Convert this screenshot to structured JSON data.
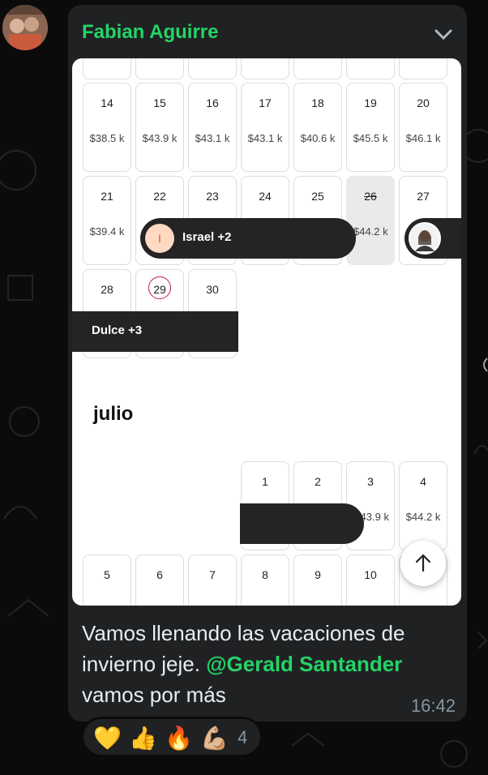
{
  "message": {
    "sender": "Fabian Aguirre",
    "text_before": "Vamos llenando las vacaciones de invierno jeje. ",
    "mention": "@Gerald Santander",
    "text_after": " vamos por más",
    "time": "16:42"
  },
  "screenshot": {
    "rows": [
      [
        {
          "day": "14",
          "price": "$38.5 k"
        },
        {
          "day": "15",
          "price": "$43.9 k"
        },
        {
          "day": "16",
          "price": "$43.1 k"
        },
        {
          "day": "17",
          "price": "$43.1 k"
        },
        {
          "day": "18",
          "price": "$40.6 k"
        },
        {
          "day": "19",
          "price": "$45.5 k"
        },
        {
          "day": "20",
          "price": "$46.1 k"
        }
      ],
      [
        {
          "day": "21",
          "price": "$39.4 k"
        },
        {
          "day": "22",
          "price": ""
        },
        {
          "day": "23",
          "price": ""
        },
        {
          "day": "24",
          "price": ""
        },
        {
          "day": "25",
          "price": ""
        },
        {
          "day": "26",
          "price": "$44.2 k"
        },
        {
          "day": "27",
          "price": ""
        }
      ]
    ],
    "june_last": [
      "28",
      "29",
      "30"
    ],
    "pill_israel": {
      "initial": "I",
      "label": "Israel +2"
    },
    "pill_dulce": {
      "label": "Dulce +3"
    },
    "month_label": "julio",
    "july_row1": [
      {
        "day": "1",
        "price": ""
      },
      {
        "day": "2",
        "price": ""
      },
      {
        "day": "3",
        "price": "43.9 k"
      },
      {
        "day": "4",
        "price": "$44.2 k"
      }
    ],
    "july_row2": [
      "5",
      "6",
      "7",
      "8",
      "9",
      "10"
    ]
  },
  "reactions": {
    "emojis": [
      "💛",
      "👍",
      "🔥",
      "💪🏼"
    ],
    "count": "4"
  },
  "icons": {
    "chevron": "chevron-down-icon",
    "scroll_up": "arrow-up-icon"
  },
  "colors": {
    "accent": "#25d366",
    "bubble": "#1f2123",
    "today_ring": "#c2185b"
  }
}
